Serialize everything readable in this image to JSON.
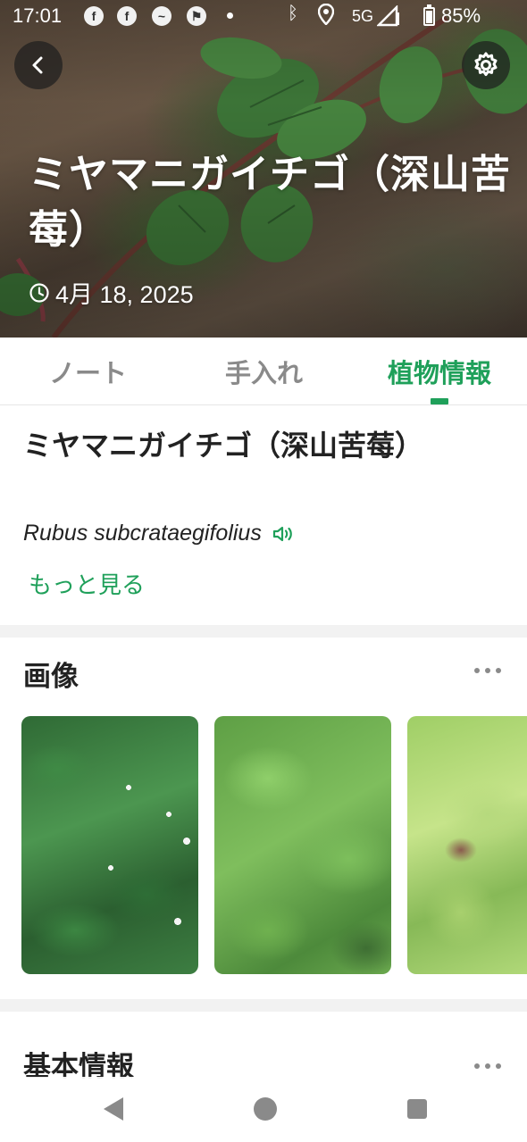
{
  "status_bar": {
    "time": "17:01",
    "network": "5G",
    "battery": "85%",
    "icons": [
      "facebook-icon",
      "facebook-icon",
      "messenger-icon",
      "activity-icon",
      "dot-icon",
      "bluetooth-icon",
      "location-icon",
      "signal-icon",
      "battery-icon"
    ]
  },
  "header": {
    "title": "ミヤマニガイチゴ（深山苦莓）",
    "date": "4月 18, 2025",
    "back_icon": "chevron-left-icon",
    "settings_icon": "gear-icon"
  },
  "tabs": [
    {
      "label": "ノート",
      "active": false
    },
    {
      "label": "手入れ",
      "active": false
    },
    {
      "label": "植物情報",
      "active": true
    }
  ],
  "plant": {
    "name": "ミヤマニガイチゴ（深山苦莓）",
    "scientific_name": "Rubus subcrataegifolius",
    "more_label": "もっと見る",
    "sound_icon": "speaker-icon"
  },
  "images_section": {
    "title": "画像",
    "thumbnails": [
      "plant-photo-1",
      "plant-photo-2",
      "plant-photo-3"
    ]
  },
  "basic_section": {
    "title": "基本情報"
  },
  "colors": {
    "accent": "#1fa05a",
    "inactive_tab": "#8a8a8a",
    "text": "#222222",
    "separator": "#f2f2f2"
  },
  "nav_bar": {
    "icons": [
      "nav-back-icon",
      "nav-home-icon",
      "nav-recent-icon"
    ]
  }
}
